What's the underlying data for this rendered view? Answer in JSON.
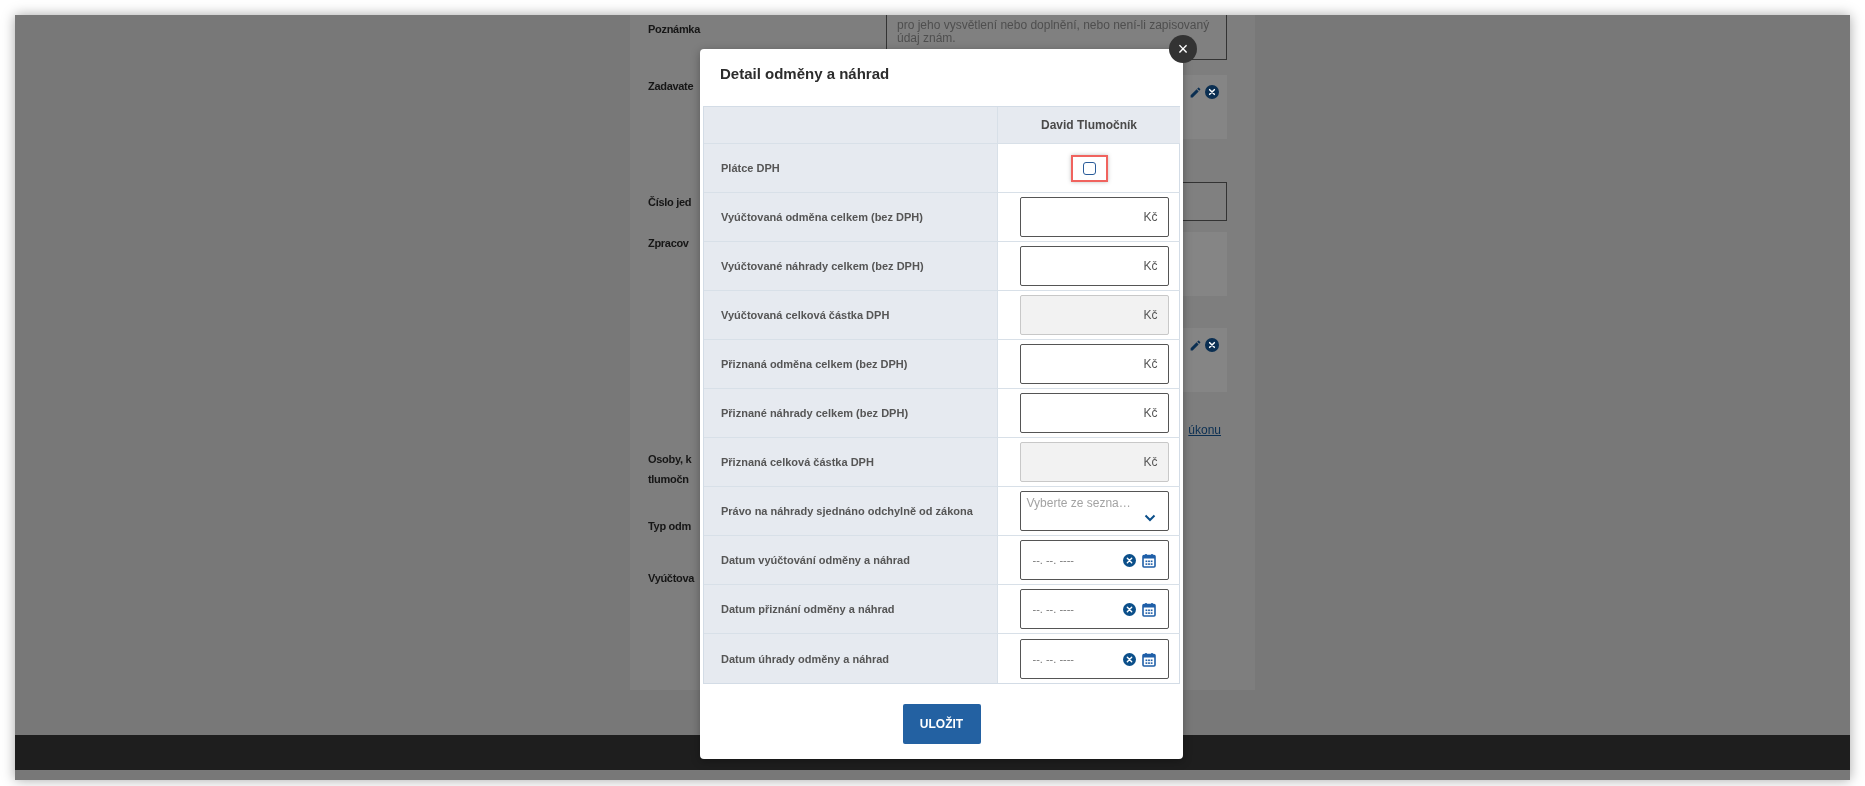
{
  "background_form": {
    "rows": [
      {
        "label": [
          "Poznámka"
        ],
        "kind": "note",
        "text": [
          "pro jeho vysvětlení nebo doplnění, nebo není-li zapisovaný",
          "údaj znám."
        ]
      },
      {
        "label": [
          "Zadavate"
        ],
        "kind": "panel_actions"
      },
      {
        "label": [
          "Číslo jed"
        ],
        "kind": "input"
      },
      {
        "label": [
          "Zpracov"
        ],
        "kind": "panel"
      },
      {
        "label": [],
        "kind": "panel_actions"
      },
      {
        "label": [],
        "kind": "link",
        "text": "úkonu"
      },
      {
        "label": [
          "Osoby, k",
          "tlumočn"
        ],
        "kind": "none"
      },
      {
        "label": [
          "Typ odm"
        ],
        "kind": "none"
      },
      {
        "label": [
          "Vyúčtova"
        ],
        "kind": "none"
      }
    ]
  },
  "modal": {
    "title": "Detail odměny a náhrad",
    "close": "×",
    "column_header": "David Tlumočník",
    "rows": [
      {
        "label": "Plátce DPH",
        "kind": "checkbox",
        "checked": false,
        "highlighted": true
      },
      {
        "label": "Vyúčtovaná odměna celkem (bez DPH)",
        "kind": "amount",
        "unit": "Kč",
        "disabled": false
      },
      {
        "label": "Vyúčtované náhrady celkem (bez DPH)",
        "kind": "amount",
        "unit": "Kč",
        "disabled": false
      },
      {
        "label": "Vyúčtovaná celková částka DPH",
        "kind": "amount",
        "unit": "Kč",
        "disabled": true
      },
      {
        "label": "Přiznaná odměna celkem (bez DPH)",
        "kind": "amount",
        "unit": "Kč",
        "disabled": false
      },
      {
        "label": "Přiznané náhrady celkem (bez DPH)",
        "kind": "amount",
        "unit": "Kč",
        "disabled": false
      },
      {
        "label": "Přiznaná celková částka DPH",
        "kind": "amount",
        "unit": "Kč",
        "disabled": true
      },
      {
        "label": "Právo na náhrady sjednáno odchylně od zákona",
        "kind": "select",
        "placeholder": "Vyberte ze sezna…"
      },
      {
        "label": "Datum vyúčtování odměny a náhrad",
        "kind": "date",
        "placeholder": "--. --. ----"
      },
      {
        "label": "Datum přiznání odměny a náhrad",
        "kind": "date",
        "placeholder": "--. --. ----"
      },
      {
        "label": "Datum úhrady odměny a náhrad",
        "kind": "date",
        "placeholder": "--. --. ----"
      }
    ],
    "save_button": "ULOŽIT"
  }
}
